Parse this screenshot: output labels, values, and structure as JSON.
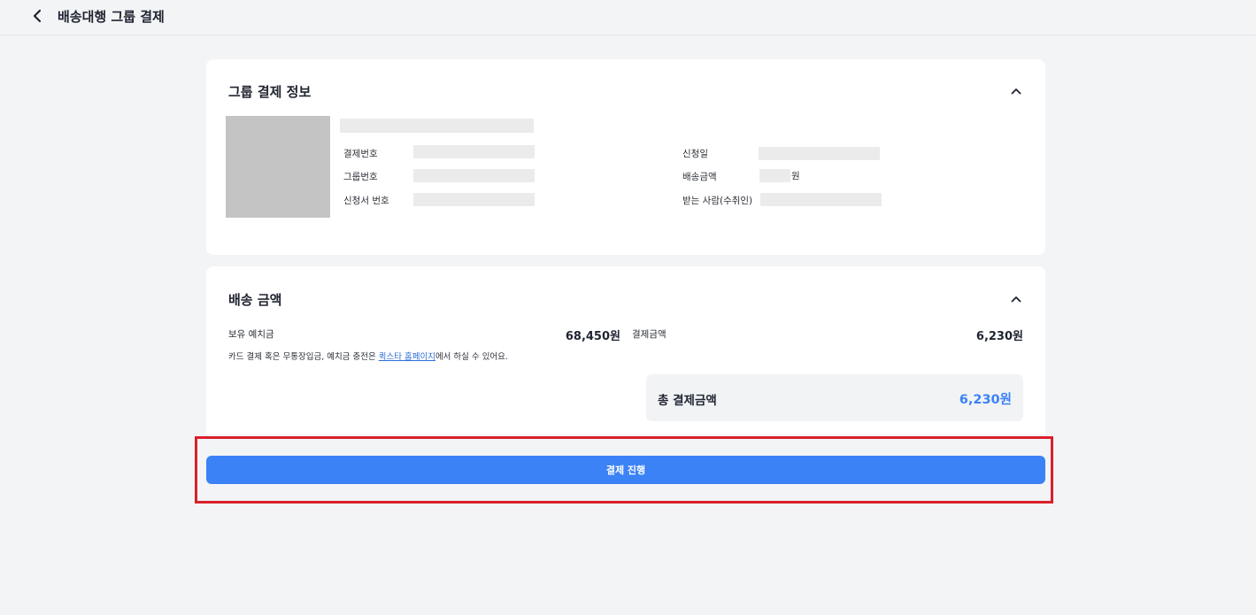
{
  "header": {
    "title": "배송대행 그룹 결제",
    "back_icon": "chevron-left-icon"
  },
  "group_info": {
    "title": "그룹 결제 정보",
    "collapse_icon": "chevron-up-icon",
    "labels": {
      "payment_no": "결제번호",
      "group_no": "그룹번호",
      "application_no": "신청서 번호",
      "request_date": "신청일",
      "shipping_amount": "배송금액",
      "recipient": "받는 사람(수취인)"
    },
    "won_unit": "원"
  },
  "shipping_amount": {
    "title": "배송 금액",
    "collapse_icon": "chevron-up-icon",
    "deposit_label": "보유 예치금",
    "deposit_value": "68,450원",
    "payment_label": "결제금액",
    "payment_value": "6,230원",
    "notice_before": "카드 결제 혹은 무통장입금, 예치금 충전은 ",
    "notice_link": "퀵스타 홈페이지",
    "notice_after": "에서 하실 수 있어요.",
    "total_label": "총 결제금액",
    "total_value": "6,230원"
  },
  "actions": {
    "pay_label": "결제 진행"
  },
  "colors": {
    "accent": "#3b82f6",
    "highlight_border": "#d8202a",
    "background": "#f3f4f6"
  }
}
